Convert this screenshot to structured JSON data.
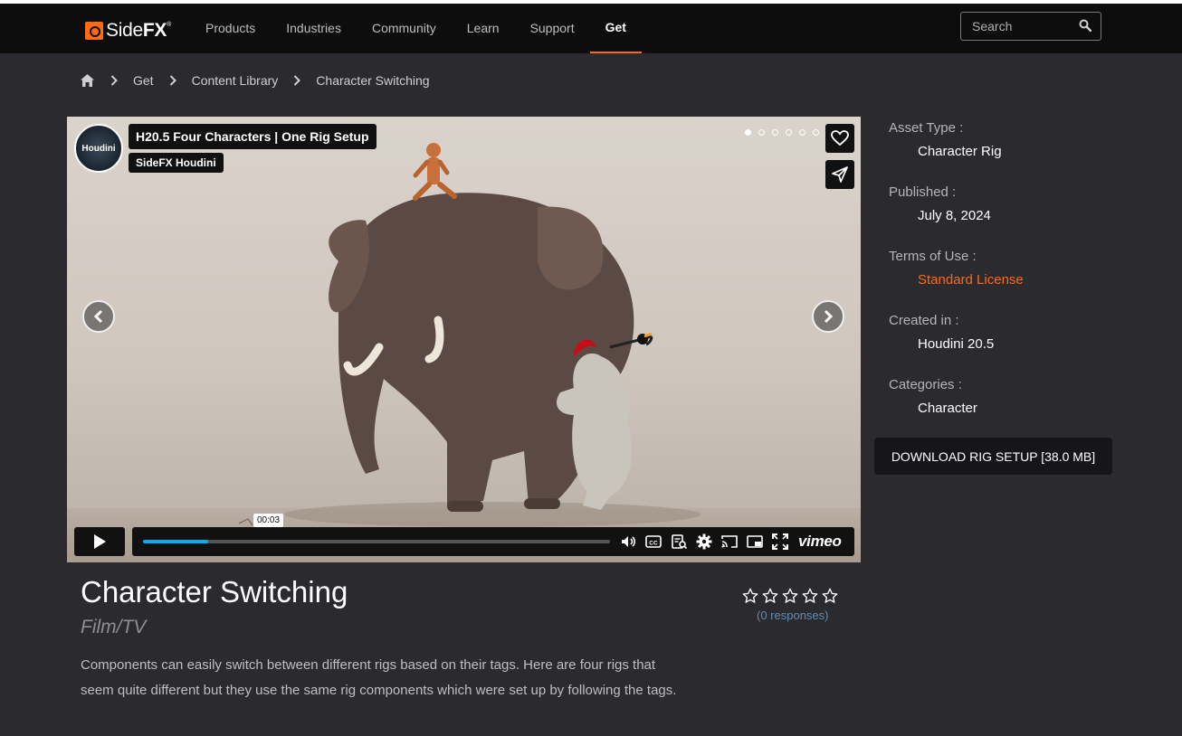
{
  "brand": {
    "name_light": "Side",
    "name_bold": "FX",
    "trademark": "®"
  },
  "nav": {
    "items": [
      {
        "label": "Products"
      },
      {
        "label": "Industries"
      },
      {
        "label": "Community"
      },
      {
        "label": "Learn"
      },
      {
        "label": "Support"
      },
      {
        "label": "Get",
        "active": true
      }
    ],
    "search_placeholder": "Search"
  },
  "breadcrumb": {
    "items": [
      "Get",
      "Content Library",
      "Character Switching"
    ]
  },
  "video": {
    "title": "H20.5 Four Characters | One Rig Setup",
    "channel": "SideFX Houdini",
    "avatar_text": "Houdini",
    "current_time": "00:03",
    "progress": 0.14,
    "carousel_dots": 6,
    "carousel_active": 0,
    "vimeo_label": "vimeo"
  },
  "meta": {
    "asset_type_label": "Asset Type :",
    "asset_type_value": "Character Rig",
    "published_label": "Published :",
    "published_value": "July 8, 2024",
    "terms_label": "Terms of Use :",
    "terms_value": "Standard License",
    "created_label": "Created in :",
    "created_value": "Houdini 20.5",
    "categories_label": "Categories :",
    "categories_value": "Character"
  },
  "download": {
    "label": "DOWNLOAD RIG SETUP [38.0 MB]"
  },
  "asset": {
    "title": "Character Switching",
    "subtitle": "Film/TV",
    "description": "Components can easily switch between different rigs based on their tags. Here are four rigs that seem quite different but they use the same rig components which were set up by following the tags."
  },
  "rating": {
    "stars": 5,
    "filled": 0,
    "responses": "(0 responses)"
  },
  "colors": {
    "accent": "#ff6a14",
    "background": "#2b2a2f",
    "header": "#0d0d0d",
    "progress": "#00adef"
  }
}
